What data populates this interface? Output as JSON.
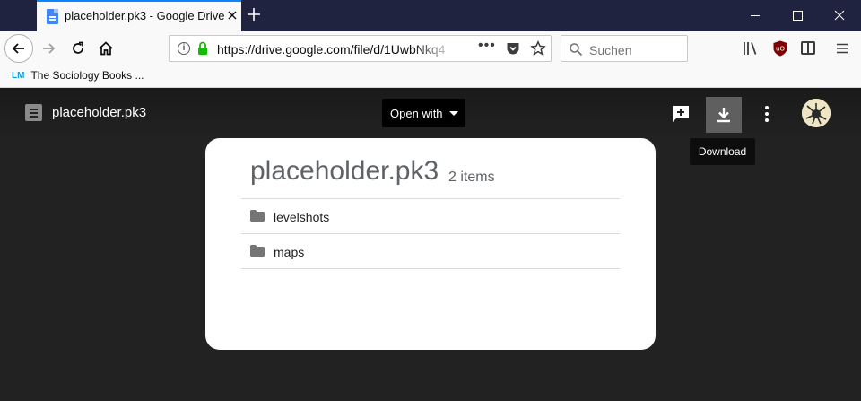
{
  "browser": {
    "tab": {
      "title": "placeholder.pk3 - Google Drive"
    },
    "url": "https://drive.google.com/file/d/1UwbNkq4",
    "search_placeholder": "Suchen",
    "bookmarks": [
      {
        "icon": "LM",
        "label": "The Sociology Books ..."
      }
    ]
  },
  "viewer": {
    "file_name": "placeholder.pk3",
    "open_with_label": "Open with",
    "download_tooltip": "Download",
    "archive": {
      "title": "placeholder.pk3",
      "count_label": "2 items",
      "entries": [
        {
          "name": "levelshots"
        },
        {
          "name": "maps"
        }
      ]
    }
  },
  "colors": {
    "titlebar": "#202340",
    "tab_accent": "#0a84ff",
    "viewer_bg": "#222222",
    "download_button": "#5f5f5f",
    "lock_green": "#12bc00"
  }
}
